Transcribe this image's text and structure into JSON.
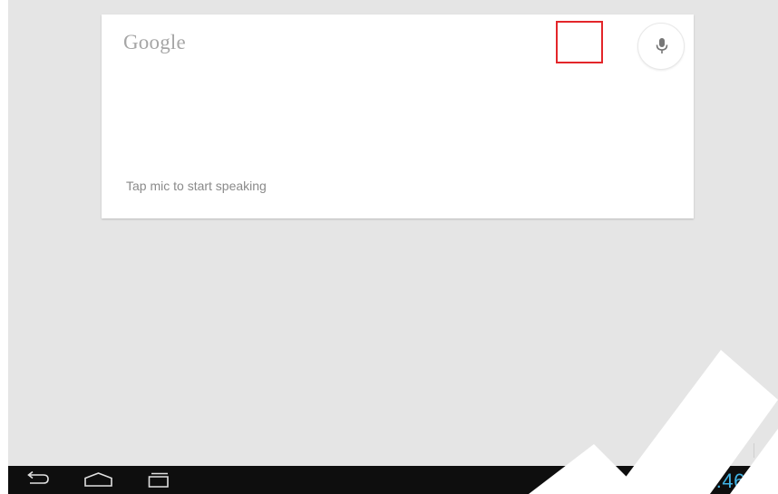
{
  "search_card": {
    "logo_text": "Google",
    "prompt": "Tap mic to start speaking",
    "mic_icon": "microphone-icon"
  },
  "navigation": {
    "back_icon": "back-icon",
    "home_icon": "home-icon",
    "recents_icon": "recent-apps-icon"
  },
  "status_bar": {
    "notification_icon": "image-icon",
    "time": "7:46",
    "battery_icon": "battery-icon"
  },
  "colors": {
    "background": "#e5e5e5",
    "card": "#ffffff",
    "nav_bar": "#0e0e0e",
    "clock_accent": "#41b4e6",
    "highlight": "#e3262a"
  }
}
